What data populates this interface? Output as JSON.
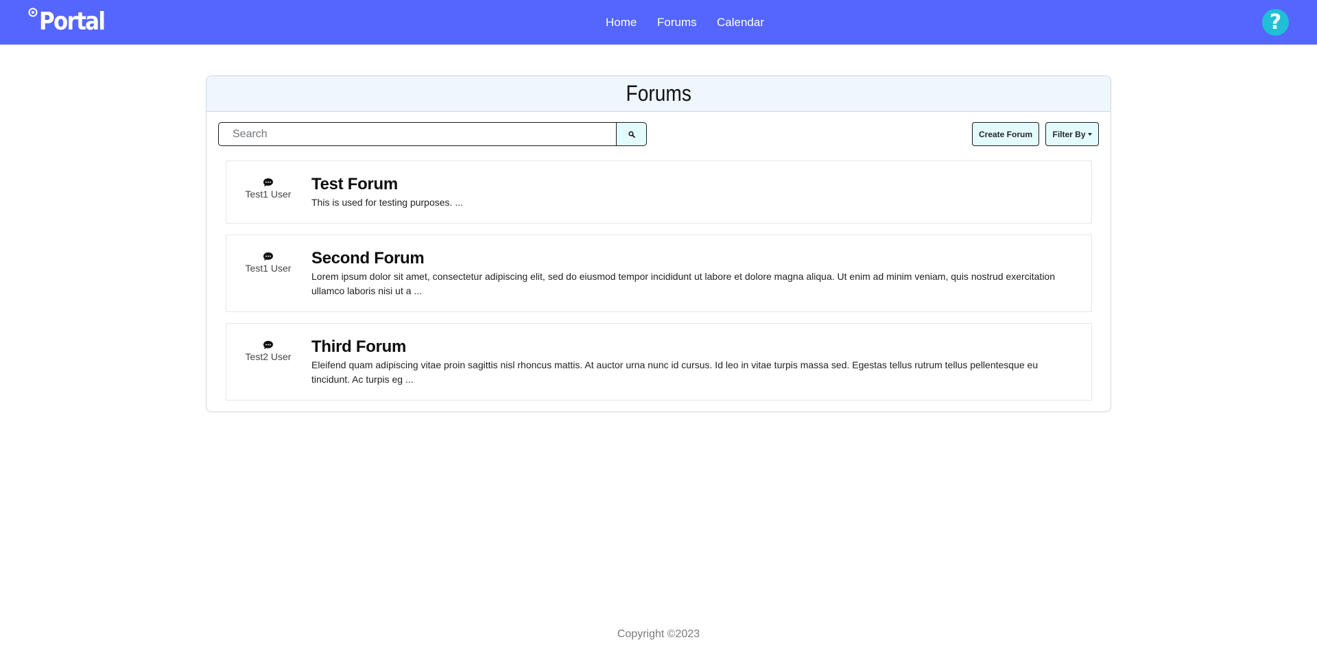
{
  "navbar": {
    "brand": "Portal",
    "links": [
      "Home",
      "Forums",
      "Calendar"
    ],
    "help_icon": "question-circle-icon",
    "help_glyph": "?",
    "bg_color": "#5566ff",
    "help_color": "#1fc0d6"
  },
  "page": {
    "title": "Forums",
    "search": {
      "placeholder": "Search",
      "value": ""
    },
    "search_icon": "magnifier-icon",
    "create_label": "Create Forum",
    "filter_label": "Filter By"
  },
  "forums": [
    {
      "author": "Test1 User",
      "title": "Test Forum",
      "description": "This is used for testing purposes. ..."
    },
    {
      "author": "Test1 User",
      "title": "Second Forum",
      "description": "Lorem ipsum dolor sit amet, consectetur adipiscing elit, sed do eiusmod tempor incididunt ut labore et dolore magna aliqua. Ut enim ad minim veniam, quis nostrud exercitation ullamco laboris nisi ut a ..."
    },
    {
      "author": "Test2 User",
      "title": "Third Forum",
      "description": "Eleifend quam adipiscing vitae proin sagittis nisl rhoncus mattis. At auctor urna nunc id cursus. Id leo in vitae turpis massa sed. Egestas tellus rutrum tellus pellentesque eu tincidunt. Ac turpis eg ..."
    }
  ],
  "footer": {
    "copyright": "Copyright ©2023"
  }
}
